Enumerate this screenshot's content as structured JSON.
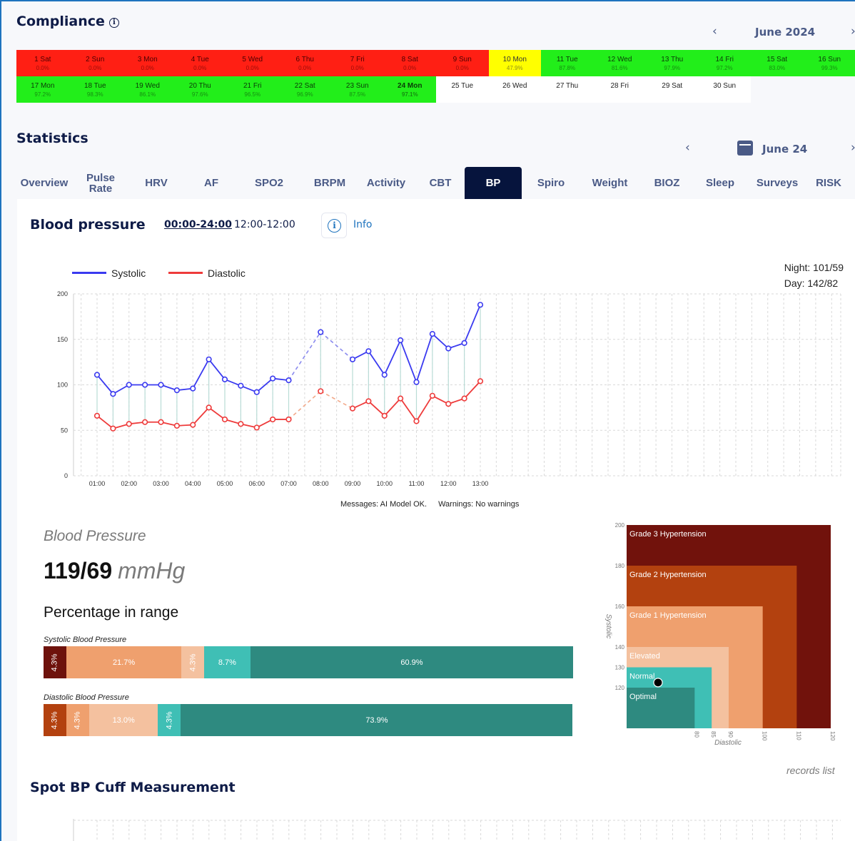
{
  "compliance": {
    "title": "Compliance",
    "month": "June 2024",
    "days": [
      {
        "label": "1 Sat",
        "pct": "0.0%",
        "status": "red"
      },
      {
        "label": "2 Sun",
        "pct": "0.0%",
        "status": "red"
      },
      {
        "label": "3 Mon",
        "pct": "0.0%",
        "status": "red"
      },
      {
        "label": "4 Tue",
        "pct": "0.0%",
        "status": "red"
      },
      {
        "label": "5 Wed",
        "pct": "0.0%",
        "status": "red"
      },
      {
        "label": "6 Thu",
        "pct": "0.0%",
        "status": "red"
      },
      {
        "label": "7 Fri",
        "pct": "0.0%",
        "status": "red"
      },
      {
        "label": "8 Sat",
        "pct": "0.0%",
        "status": "red"
      },
      {
        "label": "9 Sun",
        "pct": "0.0%",
        "status": "red"
      },
      {
        "label": "10 Mon",
        "pct": "47.9%",
        "status": "yellow"
      },
      {
        "label": "11 Tue",
        "pct": "87.8%",
        "status": "green"
      },
      {
        "label": "12 Wed",
        "pct": "81.6%",
        "status": "green"
      },
      {
        "label": "13 Thu",
        "pct": "97.9%",
        "status": "green"
      },
      {
        "label": "14 Fri",
        "pct": "97.2%",
        "status": "green"
      },
      {
        "label": "15 Sat",
        "pct": "83.0%",
        "status": "green"
      },
      {
        "label": "16 Sun",
        "pct": "99.3%",
        "status": "green"
      },
      {
        "label": "17 Mon",
        "pct": "97.2%",
        "status": "green"
      },
      {
        "label": "18 Tue",
        "pct": "98.3%",
        "status": "green"
      },
      {
        "label": "19 Wed",
        "pct": "86.1%",
        "status": "green"
      },
      {
        "label": "20 Thu",
        "pct": "97.6%",
        "status": "green"
      },
      {
        "label": "21 Fri",
        "pct": "96.5%",
        "status": "green"
      },
      {
        "label": "22 Sat",
        "pct": "96.9%",
        "status": "green"
      },
      {
        "label": "23 Sun",
        "pct": "87.5%",
        "status": "green"
      },
      {
        "label": "24 Mon",
        "pct": "97.1%",
        "status": "green",
        "today": true
      },
      {
        "label": "25 Tue",
        "pct": "",
        "status": "white"
      },
      {
        "label": "26 Wed",
        "pct": "",
        "status": "white"
      },
      {
        "label": "27 Thu",
        "pct": "",
        "status": "white"
      },
      {
        "label": "28 Fri",
        "pct": "",
        "status": "white"
      },
      {
        "label": "29 Sat",
        "pct": "",
        "status": "white"
      },
      {
        "label": "30 Sun",
        "pct": "",
        "status": "white"
      }
    ]
  },
  "statistics": {
    "title": "Statistics",
    "month": "June 24",
    "tabs": [
      "Overview",
      "Pulse Rate",
      "HRV",
      "AF",
      "SPO2",
      "BRPM",
      "Activity",
      "CBT",
      "BP",
      "Spiro",
      "Weight",
      "BIOZ",
      "Sleep",
      "Surveys",
      "RISK"
    ],
    "active_tab": "BP"
  },
  "bp": {
    "title": "Blood pressure",
    "range_full": "00:00-24:00",
    "range_half": "12:00-12:00",
    "info_label": "Info",
    "legend_systolic": "Systolic",
    "legend_diastolic": "Diastolic",
    "night": "Night: 101/59",
    "day": "Day: 142/82",
    "messages": "Messages: AI Model OK.",
    "warnings": "Warnings: No warnings",
    "subtitle": "Blood Pressure",
    "value": "119/69",
    "unit": "mmHg",
    "pir_title": "Percentage in range",
    "systolic_label": "Systolic Blood Pressure",
    "diastolic_label": "Diastolic Blood Pressure",
    "systolic_segments": [
      {
        "pct": 4.3,
        "label": "4.3%",
        "color": "#6e120c",
        "vertical": true
      },
      {
        "pct": 21.7,
        "label": "21.7%",
        "color": "#efa06e",
        "vertical": false
      },
      {
        "pct": 4.3,
        "label": "4.3%",
        "color": "#f4c19f",
        "vertical": true
      },
      {
        "pct": 8.7,
        "label": "8.7%",
        "color": "#3fbfb5",
        "vertical": false
      },
      {
        "pct": 60.9,
        "label": "60.9%",
        "color": "#2e8a80",
        "vertical": false
      }
    ],
    "diastolic_segments": [
      {
        "pct": 4.3,
        "label": "4.3%",
        "color": "#b3410f",
        "vertical": true
      },
      {
        "pct": 4.3,
        "label": "4.3%",
        "color": "#efa06e",
        "vertical": true
      },
      {
        "pct": 13.0,
        "label": "13.0%",
        "color": "#f4c19f",
        "vertical": false
      },
      {
        "pct": 4.3,
        "label": "4.3%",
        "color": "#3fbfb5",
        "vertical": true
      },
      {
        "pct": 73.9,
        "label": "73.9%",
        "color": "#2e8a80",
        "vertical": false
      }
    ],
    "records_link": "records list",
    "spot_title": "Spot BP Cuff Measurement"
  },
  "chart_data": [
    {
      "type": "line",
      "x": [
        "01:00",
        "01:30",
        "02:00",
        "02:30",
        "03:00",
        "03:30",
        "04:00",
        "04:30",
        "05:00",
        "05:30",
        "06:00",
        "06:30",
        "07:00",
        "08:00",
        "09:00",
        "09:30",
        "10:00",
        "10:30",
        "11:00",
        "11:30",
        "12:00",
        "12:30",
        "13:00"
      ],
      "x_ticks": [
        "01:00",
        "02:00",
        "03:00",
        "04:00",
        "05:00",
        "06:00",
        "07:00",
        "08:00",
        "09:00",
        "10:00",
        "11:00",
        "12:00",
        "13:00"
      ],
      "series": [
        {
          "name": "Systolic",
          "color": "#3a3af0",
          "values": [
            111,
            90,
            100,
            100,
            100,
            94,
            96,
            128,
            106,
            99,
            92,
            107,
            105,
            158,
            128,
            137,
            111,
            149,
            103,
            156,
            140,
            146,
            188
          ]
        },
        {
          "name": "Diastolic",
          "color": "#ee3b3b",
          "values": [
            66,
            52,
            57,
            59,
            59,
            55,
            56,
            75,
            62,
            57,
            53,
            62,
            62,
            93,
            74,
            82,
            66,
            85,
            60,
            88,
            79,
            85,
            104
          ]
        }
      ],
      "dashed_segment": [
        "07:00",
        "09:00"
      ],
      "ylim": [
        0,
        200
      ],
      "y_ticks": [
        0,
        50,
        100,
        150,
        200
      ],
      "grid": true,
      "legend": "top-left"
    },
    {
      "type": "heatmap",
      "title": "",
      "xlabel": "Diastolic",
      "ylabel": "Systolic",
      "zones": [
        {
          "name": "Grade 3 Hypertension",
          "diastolic_max": 120,
          "systolic_max": 200,
          "color": "#71120c"
        },
        {
          "name": "Grade 2 Hypertension",
          "diastolic_max": 110,
          "systolic_max": 180,
          "color": "#b3410f"
        },
        {
          "name": "Grade 1 Hypertension",
          "diastolic_max": 100,
          "systolic_max": 160,
          "color": "#efa06e"
        },
        {
          "name": "Elevated",
          "diastolic_max": 90,
          "systolic_max": 140,
          "color": "#f4c19f"
        },
        {
          "name": "Normal",
          "diastolic_max": 85,
          "systolic_max": 130,
          "color": "#3fbfb5"
        },
        {
          "name": "Optimal",
          "diastolic_max": 80,
          "systolic_max": 120,
          "color": "#2e8a80"
        }
      ],
      "x_ticks": [
        80,
        85,
        90,
        100,
        110,
        120
      ],
      "y_ticks": [
        120,
        130,
        140,
        160,
        180,
        200
      ],
      "point": {
        "diastolic": 69,
        "systolic": 119
      }
    }
  ]
}
